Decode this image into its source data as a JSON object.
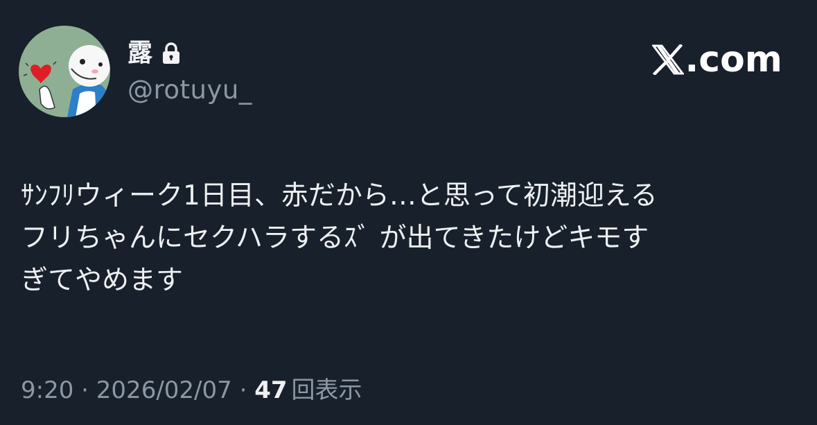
{
  "author": {
    "display_name": "露",
    "handle": "@rotuyu_",
    "avatar_icon": "avatar-image",
    "protected_icon": "lock-icon"
  },
  "brand": {
    "label": ".com",
    "icon": "x-logo-icon"
  },
  "tweet": {
    "text": "ｻﾝﾌﾘウィーク1日目、赤だから…と思って初潮迎える\nフリちゃんにセクハラするｽﾞ が出てきたけどキモす\nぎてやめます"
  },
  "meta": {
    "time": "9:20",
    "separator": " · ",
    "date": "2026/02/07",
    "views_count": "47",
    "views_label": "回表示"
  },
  "colors": {
    "background": "#18202b",
    "text": "#eef0f2",
    "muted": "#8b98a5"
  }
}
